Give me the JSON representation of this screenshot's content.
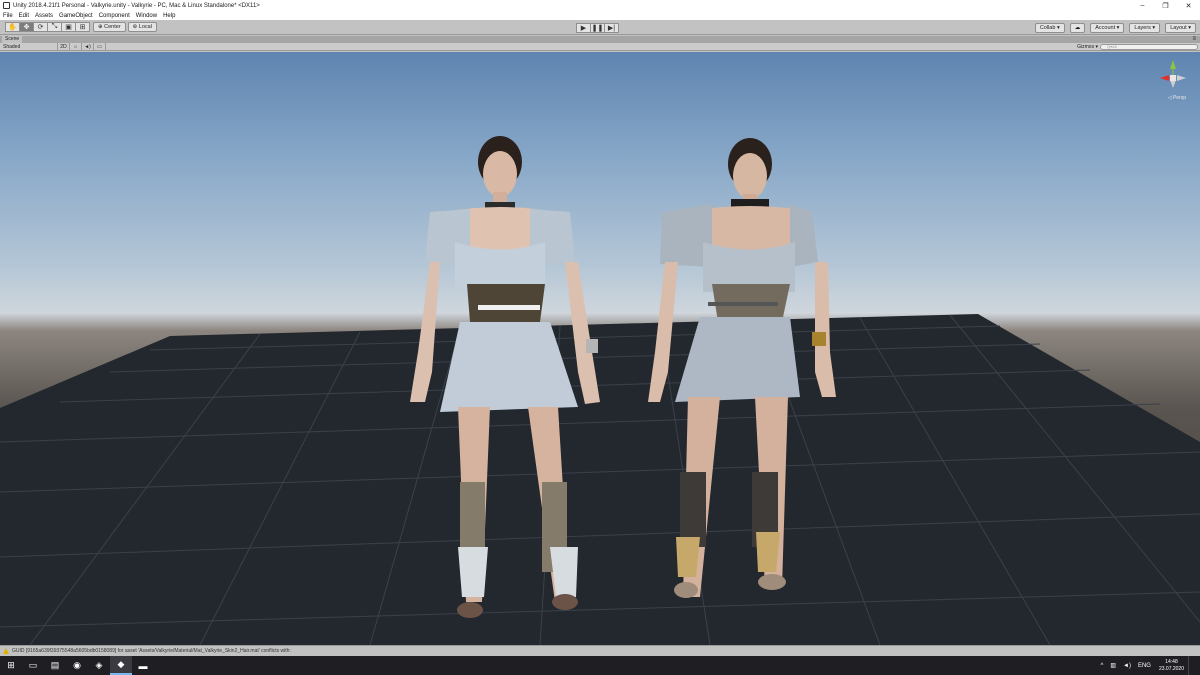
{
  "window": {
    "title": "Unity 2018.4.21f1 Personal - Valkyrie.unity - Valkyrie - PC, Mac & Linux Standalone* <DX11>",
    "controls": {
      "minimize": "–",
      "maximize": "❐",
      "close": "✕"
    }
  },
  "menu": [
    "File",
    "Edit",
    "Assets",
    "GameObject",
    "Component",
    "Window",
    "Help"
  ],
  "toolbar": {
    "tools": [
      "hand-icon",
      "move-icon",
      "rotate-icon",
      "scale-icon",
      "rect-icon",
      "transform-icon"
    ],
    "pivot_label": "Center",
    "space_label": "Local",
    "play_controls": {
      "play": "▶",
      "pause": "❚❚",
      "step": "▶|"
    },
    "collab_label": "Collab ▾",
    "cloud_label": "☁",
    "account_label": "Account ▾",
    "layers_label": "Layers ▾",
    "layout_label": "Layout ▾"
  },
  "scene": {
    "tab_label": "Scene",
    "shading_mode": "Shaded",
    "mode_2d": "2D",
    "gizmos_label": "Gizmos ▾",
    "search_placeholder": "Q▾All",
    "persp_label": "◁ Persp"
  },
  "status": {
    "message": "GUID [9165a639f39375548a5605bdb0158089] for asset 'Assets/Valkyrie/Material/Mat_Valkyrie_Skin2_Hair.mat' conflicts with:"
  },
  "taskbar": {
    "apps": [
      "windows-icon",
      "task-view-icon",
      "office-icon",
      "chrome-icon",
      "visual-studio-icon",
      "unity-icon",
      "explorer-icon"
    ],
    "tray": {
      "chevron": "^",
      "language": "ENG"
    },
    "time": "14:48",
    "date": "23.07.2020"
  },
  "colors": {
    "accent": "#76b9ed",
    "warning": "#e0b000",
    "x_axis": "#e0322b",
    "y_axis": "#8cc63e",
    "z_axis": "#3a77d9"
  }
}
